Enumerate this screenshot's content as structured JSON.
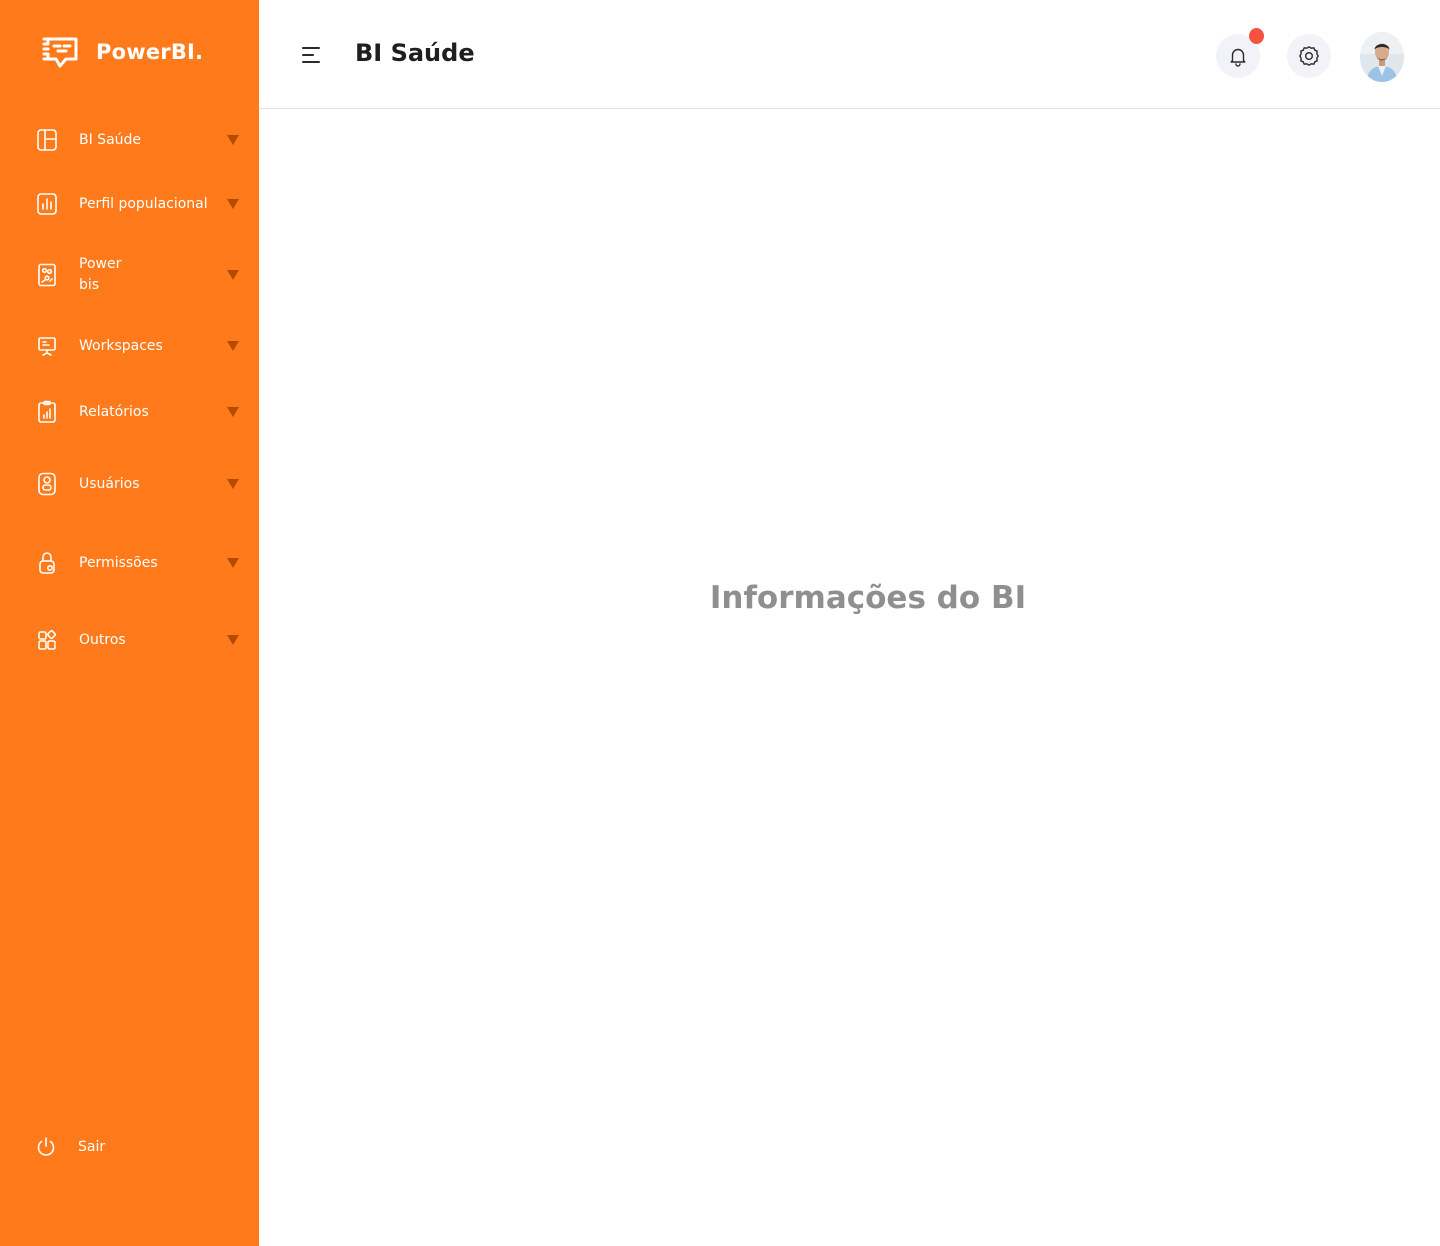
{
  "brand": {
    "name": "PowerBI."
  },
  "header": {
    "title": "BI Saúde"
  },
  "sidebar": {
    "items": [
      {
        "label": "BI Saúde",
        "icon": "layout-icon"
      },
      {
        "label": "Perfil populacional",
        "icon": "bar-chart-icon"
      },
      {
        "label": "Power\nbis",
        "icon": "power-bi-icon"
      },
      {
        "label": "Workspaces",
        "icon": "presentation-board-icon"
      },
      {
        "label": "Relatórios",
        "icon": "clipboard-chart-icon"
      },
      {
        "label": "Usuários",
        "icon": "user-badge-icon"
      },
      {
        "label": "Permissões",
        "icon": "lock-icon"
      },
      {
        "label": "Outros",
        "icon": "widgets-icon"
      }
    ],
    "logout_label": "Sair"
  },
  "main": {
    "heading": "Informações do BI"
  },
  "colors": {
    "sidebar_bg": "#FF7A1A",
    "caret": "#B34C00",
    "notification_dot": "#F5533D",
    "heading_text": "#8F8F8F"
  }
}
